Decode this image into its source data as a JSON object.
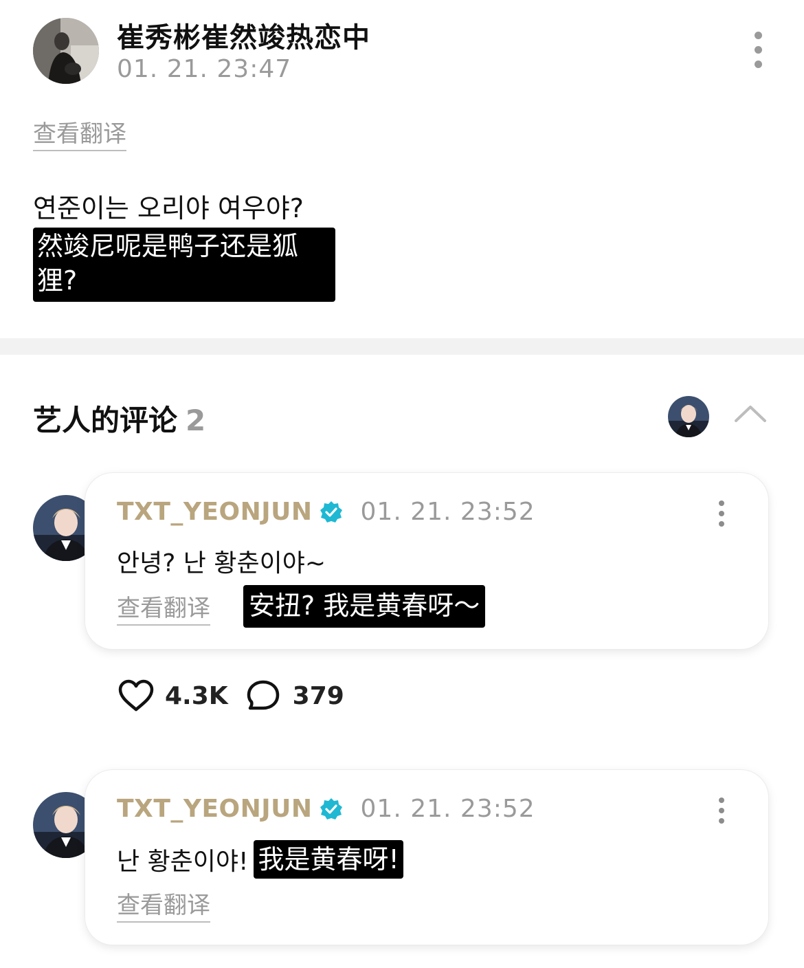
{
  "post": {
    "author": "崔秀彬崔然竣热恋中",
    "time": "01. 21. 23:47",
    "translate_label": "查看翻译",
    "body": "연준이는 오리야 여우야?",
    "caption": "然竣尼呢是鸭子还是狐狸?"
  },
  "artist_comments": {
    "title": "艺人的评论",
    "count": "2"
  },
  "comments": [
    {
      "name": "TXT_YEONJUN",
      "time": "01. 21. 23:52",
      "text": "안녕? 난 황춘이야~",
      "translate_label": "查看翻译",
      "caption": "安扭? 我是黄春呀～",
      "likes": "4.3K",
      "replies": "379"
    },
    {
      "name": "TXT_YEONJUN",
      "time": "01. 21. 23:52",
      "text": "난 황춘이야!",
      "caption": "我是黄春呀!",
      "translate_label": "查看翻译"
    }
  ],
  "colors": {
    "accent_name": "#b9a57e",
    "verified": "#1fb8d3",
    "muted": "#9a9a9a"
  },
  "icons": [
    "more-vertical-icon",
    "chevron-up-icon",
    "verified-badge-icon",
    "heart-icon",
    "comment-bubble-icon"
  ]
}
